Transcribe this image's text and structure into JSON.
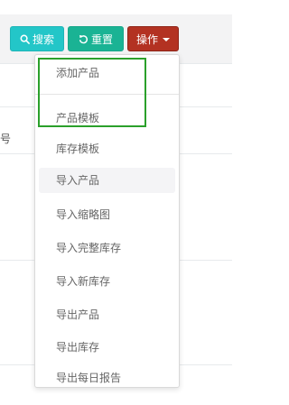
{
  "toolbar": {
    "search_label": "搜索",
    "reset_label": "重置",
    "operations_label": "操作"
  },
  "background": {
    "edge_text": "号"
  },
  "dropdown": {
    "items": [
      {
        "label": "添加产品"
      },
      {
        "label": "产品模板"
      },
      {
        "label": "库存模板"
      },
      {
        "label": "导入产品"
      },
      {
        "label": "导入缩略图"
      },
      {
        "label": "导入完整库存"
      },
      {
        "label": "导入新库存"
      },
      {
        "label": "导出产品"
      },
      {
        "label": "导出库存"
      },
      {
        "label": "导出每日报告"
      }
    ],
    "hovered_item": "导入产品"
  },
  "colors": {
    "search_button": "#23c6c8",
    "reset_button": "#1ab394",
    "operations_button": "#b33222",
    "highlight_outline": "#2ba02b"
  },
  "icons": {
    "search": "search-icon",
    "reset": "refresh-icon",
    "dropdown": "caret-down-icon"
  }
}
